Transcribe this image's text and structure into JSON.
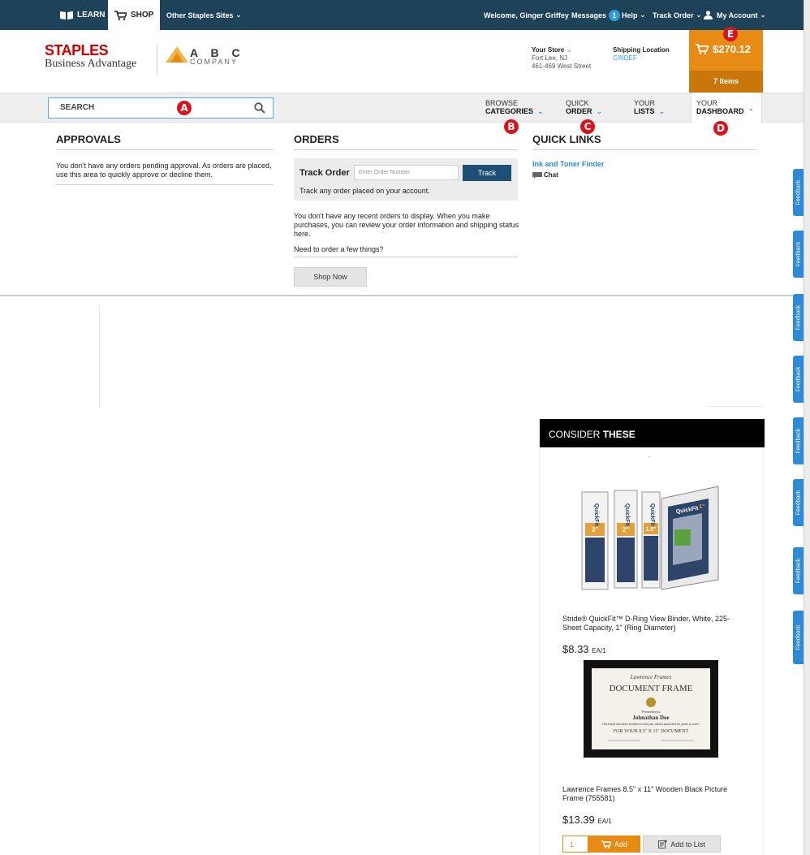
{
  "topbar": {
    "learn": "LEARN",
    "shop": "SHOP",
    "other_sites": "Other Staples Sites",
    "welcome": "Welcome, Ginger Griffey",
    "messages": "Messages",
    "messages_count": "1",
    "help": "Help",
    "track_order": "Track Order",
    "my_account": "My Account"
  },
  "header": {
    "logo_top": "STAPLES",
    "logo_bottom": "Business Advantage",
    "company_name": "A B C",
    "company_sub": "COMPANY",
    "store_label": "Your Store",
    "store_city": "Fort Lee, NJ",
    "store_street": "461-469 West Street",
    "ship_label": "Shipping Location",
    "ship_value": "CINDEF",
    "cart_total": "$270.12",
    "cart_items": "7 Items"
  },
  "nav": {
    "search_placeholder": "SEARCH",
    "browse_top": "BROWSE",
    "browse_bottom": "CATEGORIES",
    "quick_top": "QUICK",
    "quick_bottom": "ORDER",
    "lists_top": "YOUR",
    "lists_bottom": "LISTS",
    "dash_top": "YOUR",
    "dash_bottom": "DASHBOARD"
  },
  "markers": {
    "a": "A",
    "b": "B",
    "c": "C",
    "d": "D",
    "e": "E"
  },
  "approvals": {
    "title": "APPROVALS",
    "text": "You don't have any orders pending approval. As orders are placed, use this area to quickly approve or decline them."
  },
  "orders": {
    "title": "ORDERS",
    "track_label": "Track Order",
    "track_placeholder": "Enter Order Number",
    "track_button": "Track",
    "track_sub": "Track any order placed on your account.",
    "empty_text": "You don't have any recent orders to display. When you make purchases, you can review your order information and shipping status here.",
    "need_text": "Need to order a few things?",
    "shop_now": "Shop Now"
  },
  "quick_links": {
    "title": "QUICK LINKS",
    "ink_link": "Ink and Toner Finder",
    "chat": "Chat"
  },
  "consider": {
    "title_light": "CONSIDER",
    "title_bold": "THESE",
    "products": [
      {
        "name": "Stride® QuickFit™ D-Ring View Binder, White, 225-Sheet Capacity, 1\" (Ring Diameter)",
        "price": "$8.33",
        "unit": "EA/1"
      },
      {
        "name": "Lawrence Frames 8.5\" x 11\" Wooden Black Picture Frame (755581)",
        "price": "$13.39",
        "unit": "EA/1"
      }
    ],
    "binder_labels": [
      "QuickFit",
      "QuickFit",
      "QuickFit",
      "QuickFit"
    ],
    "binder_sizes": [
      "3\"",
      "2\"",
      "1.5\"",
      "1\""
    ],
    "frame_brand": "Lawrence Frames",
    "frame_title": "DOCUMENT FRAME",
    "frame_presented": "Presented to",
    "frame_name": "Johnathan Doe",
    "frame_body": "This frame has been created to hold your valued document for years to come.",
    "frame_size": "FOR YOUR 8.5\" X 11\" DOCUMENT",
    "qty_value": "1",
    "add_button": "Add",
    "add_list_button": "Add to List"
  },
  "feedback": {
    "label": "Feedback"
  },
  "colors": {
    "topbar": "#1e4258",
    "cart": "#e88b14",
    "accent_blue": "#2e8ad6",
    "marker_red": "#d9141c",
    "staples_red": "#cc0000"
  }
}
